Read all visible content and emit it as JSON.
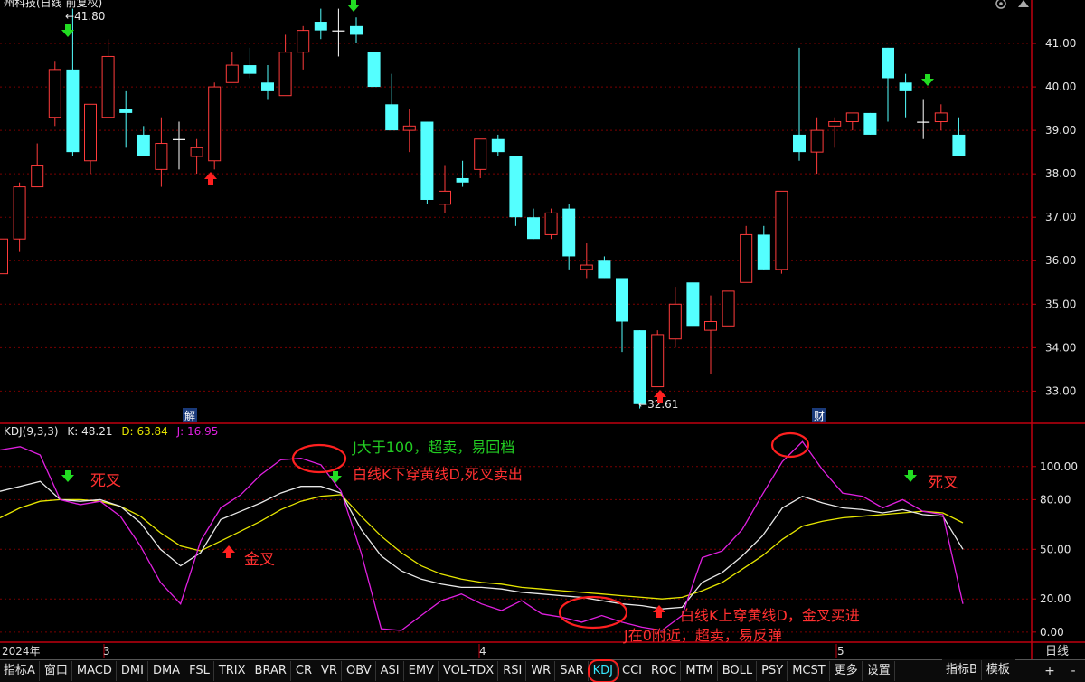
{
  "window": {
    "title_partial": "州科技(日线 前复权)",
    "period_label": "日线"
  },
  "price_panel": {
    "high_marker": "41.80",
    "low_marker": "32.61",
    "event_labels": [
      "解",
      "财"
    ],
    "colors": {
      "up": "#ff3b3b",
      "down": "#54ffff",
      "doji": "#ffffff"
    }
  },
  "kdj_panel": {
    "name": "KDJ(9,3,3)",
    "k_label": "K:",
    "k_value": "48.21",
    "d_label": "D:",
    "d_value": "63.84",
    "j_label": "J:",
    "j_value": "16.95",
    "colors": {
      "K": "#e8e8e8",
      "D": "#e6e600",
      "J": "#e020e0"
    }
  },
  "annotations": {
    "dead_cross_1": "死叉",
    "golden_cross": "金叉",
    "j_over_100": "J大于100，超卖，易回档",
    "k_cross_down": "白线K下穿黄线D,死叉卖出",
    "k_cross_up": "白线K上穿黄线D，金叉买进",
    "j_near_0": "J在0附近，超卖，易反弹",
    "dead_cross_2": "死叉"
  },
  "time_axis": [
    "2024年",
    "3",
    "4",
    "5"
  ],
  "tabs": [
    "指标A",
    "窗口",
    "MACD",
    "DMI",
    "DMA",
    "FSL",
    "TRIX",
    "BRAR",
    "CR",
    "VR",
    "OBV",
    "ASI",
    "EMV",
    "VOL-TDX",
    "RSI",
    "WR",
    "SAR",
    "KDJ",
    "CCI",
    "ROC",
    "MTM",
    "BOLL",
    "PSY",
    "MCST",
    "更多",
    "设置"
  ],
  "active_tab": "KDJ",
  "right_tab": "指标B",
  "right_tab2": "模板",
  "controls": {
    "plus": "+",
    "minus": "-"
  },
  "chart_data": [
    {
      "type": "candlestick",
      "title": "",
      "y_axis_ticks": [
        33,
        34,
        35,
        36,
        37,
        38,
        39,
        40,
        41
      ],
      "ylim": [
        32.3,
        42.0
      ],
      "candles": [
        {
          "o": 35.7,
          "h": 36.5,
          "l": 35.7,
          "c": 36.5
        },
        {
          "o": 36.5,
          "h": 37.8,
          "l": 36.2,
          "c": 37.7
        },
        {
          "o": 37.7,
          "h": 38.7,
          "l": 37.7,
          "c": 38.2
        },
        {
          "o": 39.3,
          "h": 40.6,
          "l": 39.1,
          "c": 40.4
        },
        {
          "o": 40.4,
          "h": 41.8,
          "l": 38.4,
          "c": 38.5
        },
        {
          "o": 38.3,
          "h": 39.6,
          "l": 38.0,
          "c": 39.6
        },
        {
          "o": 39.3,
          "h": 41.1,
          "l": 39.3,
          "c": 40.7
        },
        {
          "o": 39.5,
          "h": 39.9,
          "l": 38.6,
          "c": 39.4
        },
        {
          "o": 38.9,
          "h": 39.1,
          "l": 38.5,
          "c": 38.4
        },
        {
          "o": 38.1,
          "h": 39.3,
          "l": 37.7,
          "c": 38.7
        },
        {
          "o": 38.8,
          "h": 39.2,
          "l": 38.1,
          "c": 38.8
        },
        {
          "o": 38.4,
          "h": 38.8,
          "l": 38.0,
          "c": 38.6
        },
        {
          "o": 38.3,
          "h": 40.1,
          "l": 38.1,
          "c": 40.0
        },
        {
          "o": 40.1,
          "h": 40.8,
          "l": 40.1,
          "c": 40.5
        },
        {
          "o": 40.5,
          "h": 40.9,
          "l": 40.2,
          "c": 40.3
        },
        {
          "o": 40.1,
          "h": 40.5,
          "l": 39.7,
          "c": 39.9
        },
        {
          "o": 39.8,
          "h": 41.2,
          "l": 39.8,
          "c": 40.8
        },
        {
          "o": 40.8,
          "h": 41.4,
          "l": 40.4,
          "c": 41.3
        },
        {
          "o": 41.5,
          "h": 41.8,
          "l": 41.1,
          "c": 41.3
        },
        {
          "o": 41.3,
          "h": 41.8,
          "l": 40.7,
          "c": 41.3
        },
        {
          "o": 41.4,
          "h": 41.6,
          "l": 41.0,
          "c": 41.2
        },
        {
          "o": 40.8,
          "h": 40.8,
          "l": 40.0,
          "c": 40.0
        },
        {
          "o": 39.6,
          "h": 40.3,
          "l": 39.0,
          "c": 39.0
        },
        {
          "o": 39.0,
          "h": 39.5,
          "l": 38.5,
          "c": 39.1
        },
        {
          "o": 39.2,
          "h": 39.2,
          "l": 37.3,
          "c": 37.4
        },
        {
          "o": 37.3,
          "h": 38.2,
          "l": 37.1,
          "c": 37.6
        },
        {
          "o": 37.9,
          "h": 38.3,
          "l": 37.7,
          "c": 37.8
        },
        {
          "o": 38.1,
          "h": 38.8,
          "l": 37.9,
          "c": 38.8
        },
        {
          "o": 38.8,
          "h": 38.9,
          "l": 38.4,
          "c": 38.5
        },
        {
          "o": 38.4,
          "h": 38.4,
          "l": 36.8,
          "c": 37.0
        },
        {
          "o": 37.0,
          "h": 37.2,
          "l": 36.5,
          "c": 36.5
        },
        {
          "o": 36.6,
          "h": 37.2,
          "l": 36.5,
          "c": 37.1
        },
        {
          "o": 37.2,
          "h": 37.3,
          "l": 35.8,
          "c": 36.1
        },
        {
          "o": 35.8,
          "h": 36.4,
          "l": 35.6,
          "c": 35.9
        },
        {
          "o": 36.0,
          "h": 36.1,
          "l": 35.6,
          "c": 35.6
        },
        {
          "o": 35.6,
          "h": 35.6,
          "l": 33.9,
          "c": 34.6
        },
        {
          "o": 34.4,
          "h": 34.4,
          "l": 32.6,
          "c": 32.7
        },
        {
          "o": 33.1,
          "h": 34.4,
          "l": 33.1,
          "c": 34.3
        },
        {
          "o": 34.2,
          "h": 35.4,
          "l": 34.0,
          "c": 35.0
        },
        {
          "o": 35.5,
          "h": 35.5,
          "l": 34.5,
          "c": 34.5
        },
        {
          "o": 34.4,
          "h": 35.2,
          "l": 33.4,
          "c": 34.6
        },
        {
          "o": 34.5,
          "h": 35.3,
          "l": 34.5,
          "c": 35.3
        },
        {
          "o": 35.5,
          "h": 36.8,
          "l": 35.5,
          "c": 36.6
        },
        {
          "o": 36.6,
          "h": 36.8,
          "l": 35.8,
          "c": 35.8
        },
        {
          "o": 35.8,
          "h": 37.6,
          "l": 35.7,
          "c": 37.6
        },
        {
          "o": 38.9,
          "h": 40.9,
          "l": 38.3,
          "c": 38.5
        },
        {
          "o": 38.5,
          "h": 39.3,
          "l": 38.0,
          "c": 39.0
        },
        {
          "o": 39.1,
          "h": 39.3,
          "l": 38.6,
          "c": 39.2
        },
        {
          "o": 39.2,
          "h": 39.4,
          "l": 39.0,
          "c": 39.4
        },
        {
          "o": 39.4,
          "h": 39.4,
          "l": 38.9,
          "c": 38.9
        },
        {
          "o": 40.9,
          "h": 40.9,
          "l": 39.2,
          "c": 40.2
        },
        {
          "o": 40.1,
          "h": 40.3,
          "l": 39.3,
          "c": 39.9
        },
        {
          "o": 39.2,
          "h": 39.7,
          "l": 38.8,
          "c": 39.2
        },
        {
          "o": 39.2,
          "h": 39.6,
          "l": 39.0,
          "c": 39.4
        },
        {
          "o": 38.9,
          "h": 39.3,
          "l": 38.4,
          "c": 38.4
        }
      ]
    },
    {
      "type": "line",
      "title": "KDJ(9,3,3)",
      "y_axis_ticks": [
        0,
        20,
        50,
        80,
        100
      ],
      "ylim": [
        -5,
        125
      ],
      "series": [
        {
          "name": "K",
          "values": [
            85,
            88,
            91,
            80,
            79,
            80,
            76,
            66,
            50,
            40,
            48,
            68,
            73,
            78,
            84,
            88,
            88,
            84,
            62,
            46,
            37,
            32,
            29,
            27,
            27,
            26,
            24,
            23,
            22,
            21,
            19,
            17,
            16,
            14,
            15,
            30,
            36,
            46,
            58,
            75,
            82,
            78,
            75,
            74,
            72,
            74,
            71,
            70,
            50
          ]
        },
        {
          "name": "D",
          "values": [
            69,
            75,
            79,
            80,
            80,
            79,
            76,
            70,
            60,
            52,
            49,
            55,
            61,
            67,
            74,
            79,
            82,
            83,
            70,
            58,
            48,
            40,
            35,
            32,
            30,
            29,
            27,
            26,
            25,
            24,
            23,
            22,
            21,
            20,
            21,
            25,
            30,
            38,
            46,
            56,
            64,
            67,
            69,
            70,
            71,
            72,
            73,
            72,
            66
          ]
        },
        {
          "name": "J",
          "values": [
            110,
            112,
            107,
            80,
            77,
            79,
            70,
            52,
            30,
            17,
            55,
            75,
            83,
            95,
            104,
            105,
            101,
            85,
            48,
            2,
            1,
            10,
            19,
            23,
            17,
            13,
            19,
            11,
            9,
            6,
            10,
            6,
            3,
            1,
            10,
            45,
            49,
            62,
            83,
            103,
            115,
            98,
            84,
            82,
            75,
            80,
            73,
            71,
            17
          ]
        }
      ]
    }
  ]
}
